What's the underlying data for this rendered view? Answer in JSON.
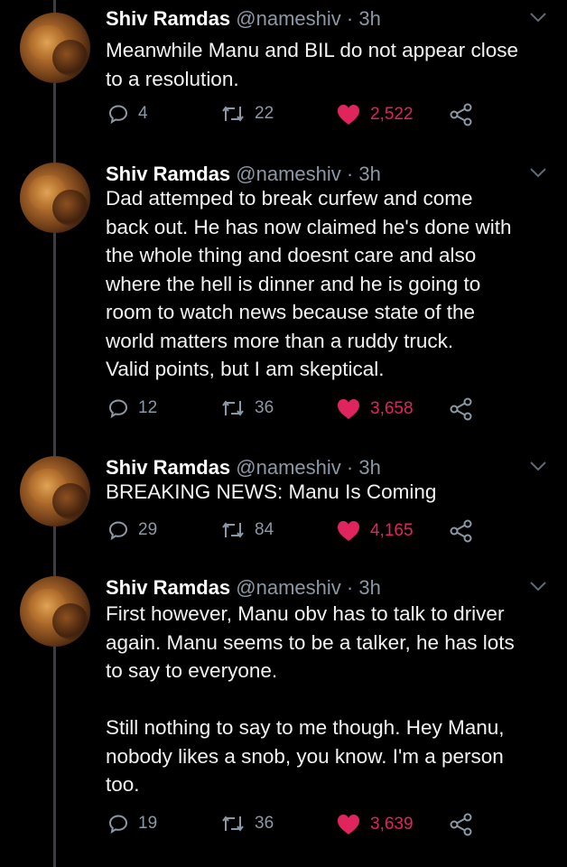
{
  "tweets": [
    {
      "name": "Shiv Ramdas",
      "handle": "@nameshiv",
      "time": "· 3h",
      "text": "Meanwhile Manu and BIL do not appear close\nto a resolution.",
      "replies": "4",
      "retweets": "22",
      "likes": "2,522"
    },
    {
      "name": "Shiv Ramdas",
      "handle": "@nameshiv",
      "time": "· 3h",
      "text": "Dad attemped to break curfew and come\nback out. He has now claimed he's done with\nthe whole thing and doesnt care and also\nwhere the hell is dinner and he is going to\nroom to watch news because state of the\nworld matters more than a ruddy truck.\nValid points, but I am skeptical.",
      "replies": "12",
      "retweets": "36",
      "likes": "3,658"
    },
    {
      "name": "Shiv Ramdas",
      "handle": "@nameshiv",
      "time": "· 3h",
      "text": "BREAKING NEWS: Manu Is Coming",
      "replies": "29",
      "retweets": "84",
      "likes": "4,165"
    },
    {
      "name": "Shiv Ramdas",
      "handle": "@nameshiv",
      "time": "· 3h",
      "text": "First however, Manu obv has to talk to driver\nagain. Manu seems to be a talker, he has lots\nto say to everyone.\n\nStill nothing to say to me though. Hey Manu,\nnobody likes a snob, you know. I'm a person\ntoo.",
      "replies": "19",
      "retweets": "36",
      "likes": "3,639"
    }
  ],
  "icons": {
    "reply": "reply-icon",
    "retweet": "retweet-icon",
    "like": "heart-icon",
    "share": "share-icon",
    "more": "chevron-down-icon"
  },
  "colors": {
    "background": "#000000",
    "text": "#f2f2f2",
    "secondary": "#8b98a5",
    "like": "#e0245e",
    "thread_line": "#3a3d42"
  }
}
